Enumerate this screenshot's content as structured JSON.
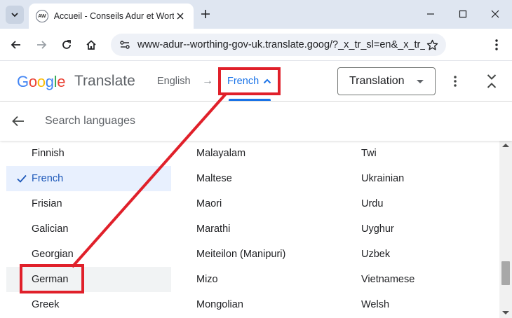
{
  "browser": {
    "tab_title": "Accueil - Conseils Adur et Worthing",
    "favicon_text": "AW",
    "url": "www-adur--worthing-gov-uk.translate.goog/?_x_tr_sl=en&_x_tr_tl=fr"
  },
  "translate_bar": {
    "logo_letters": [
      "G",
      "o",
      "o",
      "g",
      "l",
      "e"
    ],
    "logo_colors": [
      "#4285f4",
      "#ea4335",
      "#fbbc05",
      "#4285f4",
      "#34a853",
      "#ea4335"
    ],
    "product_name": "Translate",
    "source_language": "English",
    "target_language": "French",
    "mode": "Translation"
  },
  "search": {
    "placeholder": "Search languages"
  },
  "languages": {
    "col1": [
      "Finnish",
      "French",
      "Frisian",
      "Galician",
      "Georgian",
      "German",
      "Greek"
    ],
    "col2": [
      "Malayalam",
      "Maltese",
      "Maori",
      "Marathi",
      "Meiteilon (Manipuri)",
      "Mizo",
      "Mongolian"
    ],
    "col3": [
      "Twi",
      "Ukrainian",
      "Urdu",
      "Uyghur",
      "Uzbek",
      "Vietnamese",
      "Welsh"
    ],
    "selected": "French",
    "hovered": "German"
  },
  "colors": {
    "accent": "#1a73e8",
    "annotation": "#e0202a",
    "selected_bg": "#e8f0fe"
  }
}
